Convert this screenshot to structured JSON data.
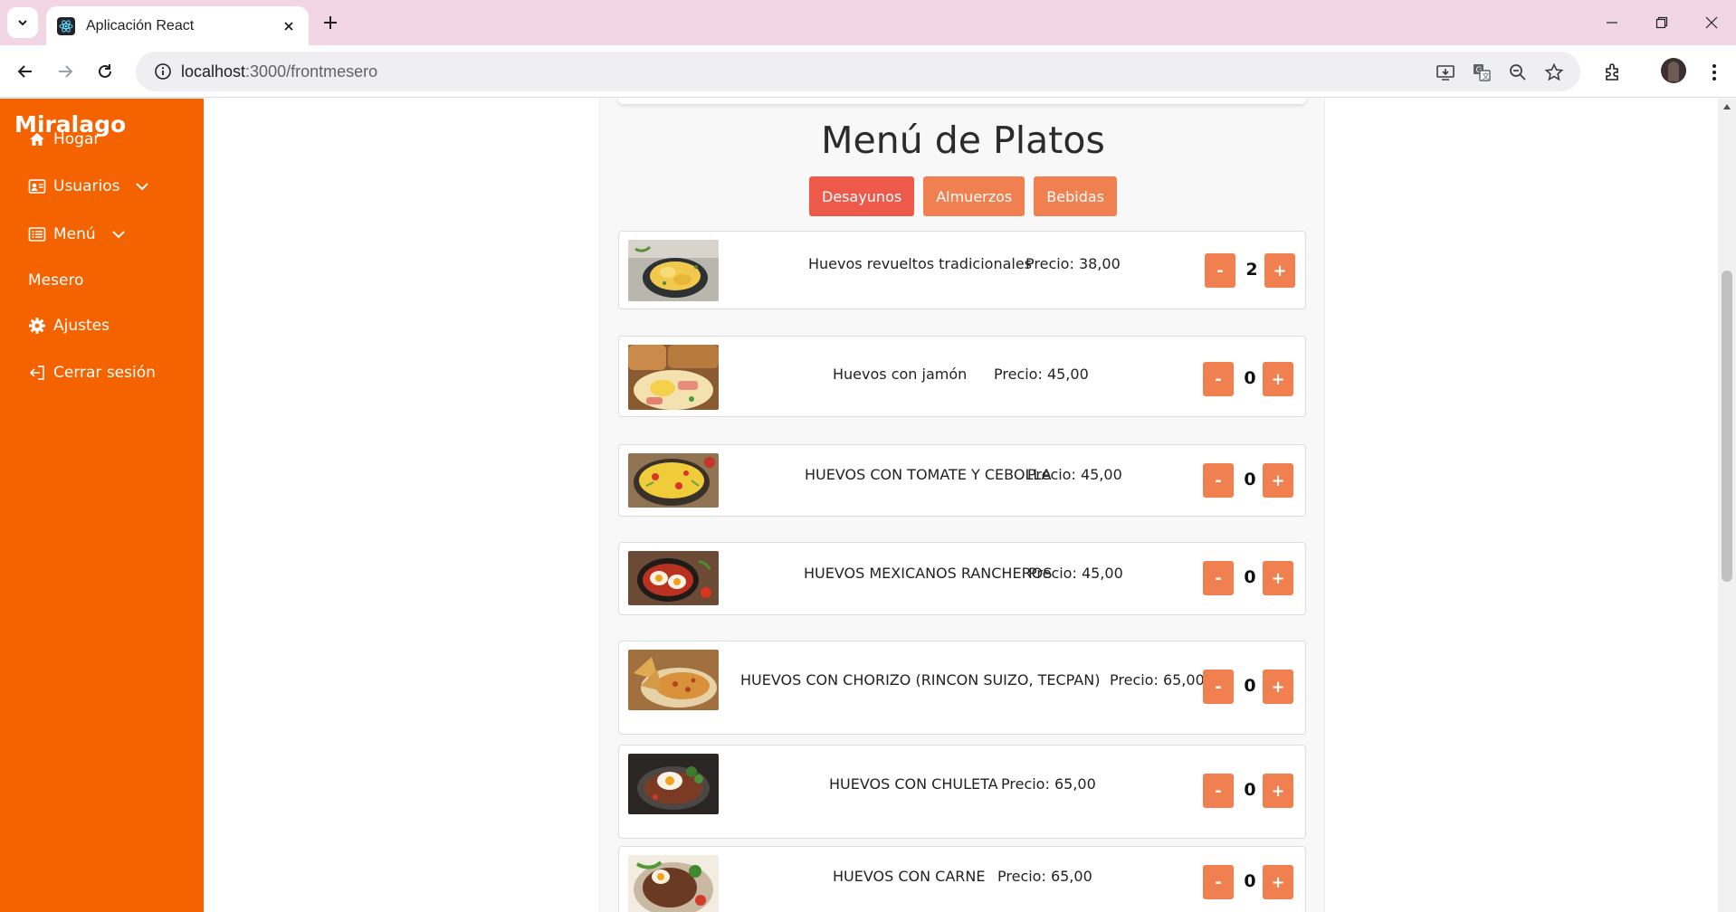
{
  "browser": {
    "tab_title": "Aplicación React",
    "url_host": "localhost",
    "url_path": ":3000/frontmesero"
  },
  "sidebar": {
    "brand": "Miralago",
    "items": [
      {
        "label": "Hogar",
        "icon": "home-icon"
      },
      {
        "label": "Usuarios",
        "icon": "user-card-icon",
        "expandable": true
      },
      {
        "label": "Menú",
        "icon": "menu-list-icon",
        "expandable": true
      },
      {
        "label": "Mesero",
        "icon": ""
      },
      {
        "label": "Ajustes",
        "icon": "gear-icon"
      },
      {
        "label": "Cerrar sesión",
        "icon": "logout-icon"
      }
    ]
  },
  "menu": {
    "title": "Menú de Platos",
    "categories": [
      {
        "label": "Desayunos",
        "active": true
      },
      {
        "label": "Almuerzos",
        "active": false
      },
      {
        "label": "Bebidas",
        "active": false
      }
    ],
    "dishes": [
      {
        "name": "Huevos revueltos tradicionales",
        "price": "Precio: 38,00",
        "qty": "2",
        "image": "scrambled-eggs-pan"
      },
      {
        "name": "Huevos con jamón",
        "price": "Precio: 45,00",
        "qty": "0",
        "image": "eggs-ham-toast"
      },
      {
        "name": "HUEVOS CON TOMATE Y CEBOLLA",
        "price": "Precio: 45,00",
        "qty": "0",
        "image": "eggs-tomato-onion"
      },
      {
        "name": "HUEVOS MEXICANOS RANCHEROS",
        "price": "Precio: 45,00",
        "qty": "0",
        "image": "huevos-rancheros-pan"
      },
      {
        "name": "HUEVOS CON CHORIZO (RINCON SUIZO, TECPAN)",
        "price": "Precio: 65,00",
        "qty": "0",
        "image": "eggs-chorizo-tortilla"
      },
      {
        "name": "HUEVOS CON CHULETA",
        "price": "Precio: 65,00",
        "qty": "0",
        "image": "eggs-pork-chop"
      },
      {
        "name": "HUEVOS CON CARNE",
        "price": "Precio: 65,00",
        "qty": "0",
        "image": "eggs-steak"
      }
    ],
    "minus_label": "-",
    "plus_label": "+"
  },
  "colors": {
    "sidebar": "#f56200",
    "button": "#f08050",
    "button_active": "#ee5a4a",
    "tabstrip": "#f2d6e6"
  }
}
